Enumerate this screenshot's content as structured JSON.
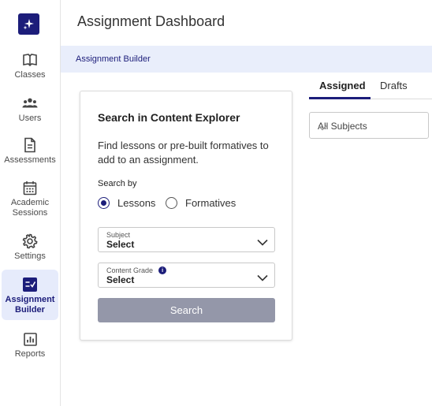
{
  "sidebar": {
    "logo_icon": "sparkle-logo-icon",
    "items": [
      {
        "label": "Classes",
        "icon": "open-book-icon"
      },
      {
        "label": "Users",
        "icon": "users-icon"
      },
      {
        "label": "Assessments",
        "icon": "document-icon"
      },
      {
        "label": "Academic Sessions",
        "icon": "calendar-icon"
      },
      {
        "label": "Settings",
        "icon": "gear-icon"
      },
      {
        "label": "Assignment Builder",
        "icon": "checklist-icon",
        "active": true
      },
      {
        "label": "Reports",
        "icon": "bar-chart-icon"
      }
    ]
  },
  "header": {
    "title": "Assignment Dashboard",
    "breadcrumb": "Assignment Builder"
  },
  "explorer": {
    "title": "Search in Content Explorer",
    "description": "Find lessons or pre-built formatives to add to an assignment.",
    "search_by_label": "Search by",
    "options": [
      {
        "label": "Lessons",
        "checked": true
      },
      {
        "label": "Formatives",
        "checked": false
      }
    ],
    "subject": {
      "label": "Subject",
      "value": "Select"
    },
    "grade": {
      "label": "Content Grade",
      "value": "Select"
    },
    "search_button": "Search"
  },
  "tabs": [
    {
      "label": "Assigned",
      "active": true
    },
    {
      "label": "Drafts",
      "active": false
    }
  ],
  "subject_filter": {
    "value": "All Subjects"
  },
  "colors": {
    "brand": "#1c1d7a",
    "subbar_bg": "#e9eefb",
    "active_nav_bg": "#e6ebfb",
    "button_disabled": "#9497a9"
  }
}
